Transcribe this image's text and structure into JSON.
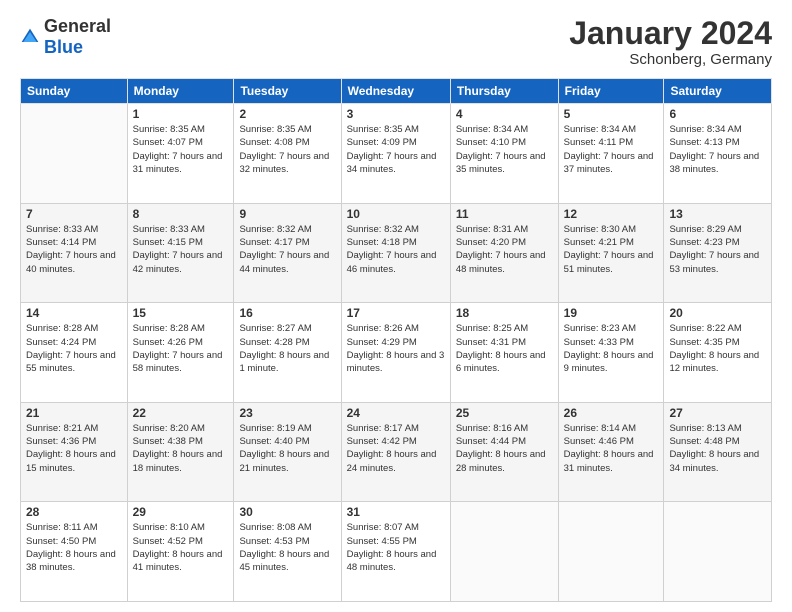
{
  "logo": {
    "text_general": "General",
    "text_blue": "Blue"
  },
  "header": {
    "month": "January 2024",
    "location": "Schonberg, Germany"
  },
  "weekdays": [
    "Sunday",
    "Monday",
    "Tuesday",
    "Wednesday",
    "Thursday",
    "Friday",
    "Saturday"
  ],
  "weeks": [
    [
      {
        "day": "",
        "sunrise": "",
        "sunset": "",
        "daylight": ""
      },
      {
        "day": "1",
        "sunrise": "Sunrise: 8:35 AM",
        "sunset": "Sunset: 4:07 PM",
        "daylight": "Daylight: 7 hours and 31 minutes."
      },
      {
        "day": "2",
        "sunrise": "Sunrise: 8:35 AM",
        "sunset": "Sunset: 4:08 PM",
        "daylight": "Daylight: 7 hours and 32 minutes."
      },
      {
        "day": "3",
        "sunrise": "Sunrise: 8:35 AM",
        "sunset": "Sunset: 4:09 PM",
        "daylight": "Daylight: 7 hours and 34 minutes."
      },
      {
        "day": "4",
        "sunrise": "Sunrise: 8:34 AM",
        "sunset": "Sunset: 4:10 PM",
        "daylight": "Daylight: 7 hours and 35 minutes."
      },
      {
        "day": "5",
        "sunrise": "Sunrise: 8:34 AM",
        "sunset": "Sunset: 4:11 PM",
        "daylight": "Daylight: 7 hours and 37 minutes."
      },
      {
        "day": "6",
        "sunrise": "Sunrise: 8:34 AM",
        "sunset": "Sunset: 4:13 PM",
        "daylight": "Daylight: 7 hours and 38 minutes."
      }
    ],
    [
      {
        "day": "7",
        "sunrise": "Sunrise: 8:33 AM",
        "sunset": "Sunset: 4:14 PM",
        "daylight": "Daylight: 7 hours and 40 minutes."
      },
      {
        "day": "8",
        "sunrise": "Sunrise: 8:33 AM",
        "sunset": "Sunset: 4:15 PM",
        "daylight": "Daylight: 7 hours and 42 minutes."
      },
      {
        "day": "9",
        "sunrise": "Sunrise: 8:32 AM",
        "sunset": "Sunset: 4:17 PM",
        "daylight": "Daylight: 7 hours and 44 minutes."
      },
      {
        "day": "10",
        "sunrise": "Sunrise: 8:32 AM",
        "sunset": "Sunset: 4:18 PM",
        "daylight": "Daylight: 7 hours and 46 minutes."
      },
      {
        "day": "11",
        "sunrise": "Sunrise: 8:31 AM",
        "sunset": "Sunset: 4:20 PM",
        "daylight": "Daylight: 7 hours and 48 minutes."
      },
      {
        "day": "12",
        "sunrise": "Sunrise: 8:30 AM",
        "sunset": "Sunset: 4:21 PM",
        "daylight": "Daylight: 7 hours and 51 minutes."
      },
      {
        "day": "13",
        "sunrise": "Sunrise: 8:29 AM",
        "sunset": "Sunset: 4:23 PM",
        "daylight": "Daylight: 7 hours and 53 minutes."
      }
    ],
    [
      {
        "day": "14",
        "sunrise": "Sunrise: 8:28 AM",
        "sunset": "Sunset: 4:24 PM",
        "daylight": "Daylight: 7 hours and 55 minutes."
      },
      {
        "day": "15",
        "sunrise": "Sunrise: 8:28 AM",
        "sunset": "Sunset: 4:26 PM",
        "daylight": "Daylight: 7 hours and 58 minutes."
      },
      {
        "day": "16",
        "sunrise": "Sunrise: 8:27 AM",
        "sunset": "Sunset: 4:28 PM",
        "daylight": "Daylight: 8 hours and 1 minute."
      },
      {
        "day": "17",
        "sunrise": "Sunrise: 8:26 AM",
        "sunset": "Sunset: 4:29 PM",
        "daylight": "Daylight: 8 hours and 3 minutes."
      },
      {
        "day": "18",
        "sunrise": "Sunrise: 8:25 AM",
        "sunset": "Sunset: 4:31 PM",
        "daylight": "Daylight: 8 hours and 6 minutes."
      },
      {
        "day": "19",
        "sunrise": "Sunrise: 8:23 AM",
        "sunset": "Sunset: 4:33 PM",
        "daylight": "Daylight: 8 hours and 9 minutes."
      },
      {
        "day": "20",
        "sunrise": "Sunrise: 8:22 AM",
        "sunset": "Sunset: 4:35 PM",
        "daylight": "Daylight: 8 hours and 12 minutes."
      }
    ],
    [
      {
        "day": "21",
        "sunrise": "Sunrise: 8:21 AM",
        "sunset": "Sunset: 4:36 PM",
        "daylight": "Daylight: 8 hours and 15 minutes."
      },
      {
        "day": "22",
        "sunrise": "Sunrise: 8:20 AM",
        "sunset": "Sunset: 4:38 PM",
        "daylight": "Daylight: 8 hours and 18 minutes."
      },
      {
        "day": "23",
        "sunrise": "Sunrise: 8:19 AM",
        "sunset": "Sunset: 4:40 PM",
        "daylight": "Daylight: 8 hours and 21 minutes."
      },
      {
        "day": "24",
        "sunrise": "Sunrise: 8:17 AM",
        "sunset": "Sunset: 4:42 PM",
        "daylight": "Daylight: 8 hours and 24 minutes."
      },
      {
        "day": "25",
        "sunrise": "Sunrise: 8:16 AM",
        "sunset": "Sunset: 4:44 PM",
        "daylight": "Daylight: 8 hours and 28 minutes."
      },
      {
        "day": "26",
        "sunrise": "Sunrise: 8:14 AM",
        "sunset": "Sunset: 4:46 PM",
        "daylight": "Daylight: 8 hours and 31 minutes."
      },
      {
        "day": "27",
        "sunrise": "Sunrise: 8:13 AM",
        "sunset": "Sunset: 4:48 PM",
        "daylight": "Daylight: 8 hours and 34 minutes."
      }
    ],
    [
      {
        "day": "28",
        "sunrise": "Sunrise: 8:11 AM",
        "sunset": "Sunset: 4:50 PM",
        "daylight": "Daylight: 8 hours and 38 minutes."
      },
      {
        "day": "29",
        "sunrise": "Sunrise: 8:10 AM",
        "sunset": "Sunset: 4:52 PM",
        "daylight": "Daylight: 8 hours and 41 minutes."
      },
      {
        "day": "30",
        "sunrise": "Sunrise: 8:08 AM",
        "sunset": "Sunset: 4:53 PM",
        "daylight": "Daylight: 8 hours and 45 minutes."
      },
      {
        "day": "31",
        "sunrise": "Sunrise: 8:07 AM",
        "sunset": "Sunset: 4:55 PM",
        "daylight": "Daylight: 8 hours and 48 minutes."
      },
      {
        "day": "",
        "sunrise": "",
        "sunset": "",
        "daylight": ""
      },
      {
        "day": "",
        "sunrise": "",
        "sunset": "",
        "daylight": ""
      },
      {
        "day": "",
        "sunrise": "",
        "sunset": "",
        "daylight": ""
      }
    ]
  ]
}
